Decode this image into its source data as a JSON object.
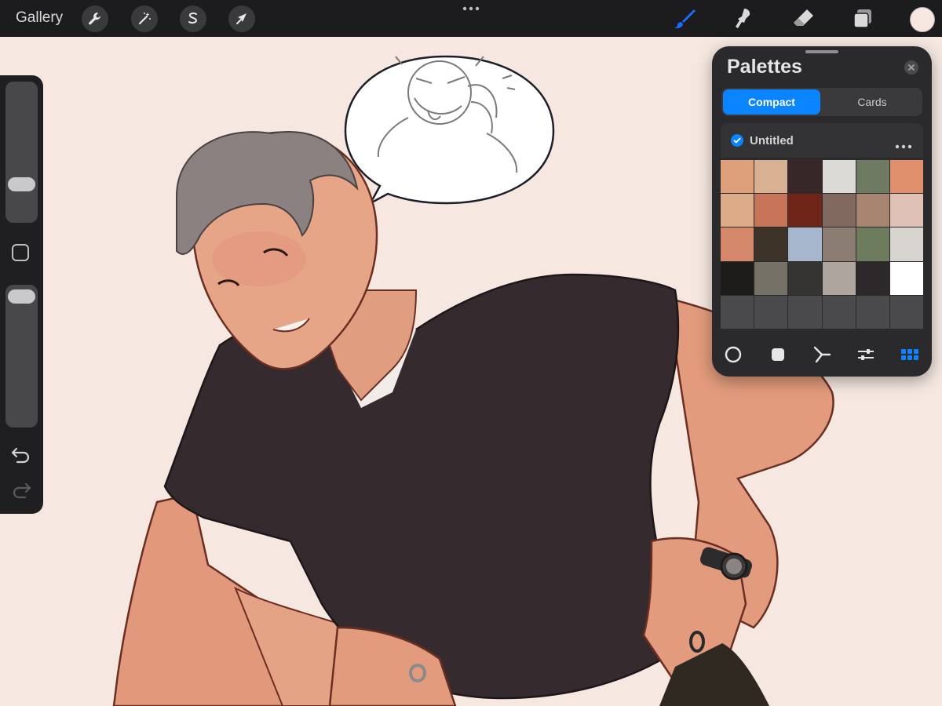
{
  "topbar": {
    "gallery_label": "Gallery",
    "left_tools": [
      "wrench-icon",
      "magic-wand-icon",
      "selection-icon",
      "transform-arrow-icon"
    ],
    "right_tools": [
      "brush-icon",
      "smudge-icon",
      "eraser-icon",
      "layers-icon"
    ],
    "active_tool": "brush-icon",
    "active_color": "#f6e8e1",
    "accent": "#1a6cff"
  },
  "sidebar": {
    "size_slider_value": 0.35,
    "opacity_slider_value": 0.95,
    "icons": [
      "modify-icon",
      "undo-icon",
      "redo-icon"
    ]
  },
  "palettes": {
    "title": "Palettes",
    "tabs": [
      {
        "label": "Compact",
        "active": true
      },
      {
        "label": "Cards",
        "active": false
      }
    ],
    "palette_name": "Untitled",
    "palette_default": true,
    "swatches": [
      "#dea07a",
      "#d8b092",
      "#372728",
      "#dcdad4",
      "#6f7a63",
      "#e0906d",
      "#dcab88",
      "#c87458",
      "#6f2517",
      "#80695e",
      "#a88570",
      "#dfc0b4",
      "#d5876a",
      "#3d3329",
      "#a5b6cd",
      "#8b7d71",
      "#6c7c5c",
      "#d8d4cf",
      "#1e1c1b",
      "#767166",
      "#363432",
      "#ada59e",
      "#2d2829",
      "#ffffff",
      "#4a4a4c",
      "#4a4a4c",
      "#4a4a4c",
      "#4a4a4c",
      "#4a4a4c",
      "#4a4a4c"
    ],
    "bottom_modes": [
      "disc-icon",
      "classic-icon",
      "harmony-icon",
      "value-icon",
      "palettes-icon"
    ],
    "active_mode": "palettes-icon",
    "accent": "#0a84ff"
  }
}
